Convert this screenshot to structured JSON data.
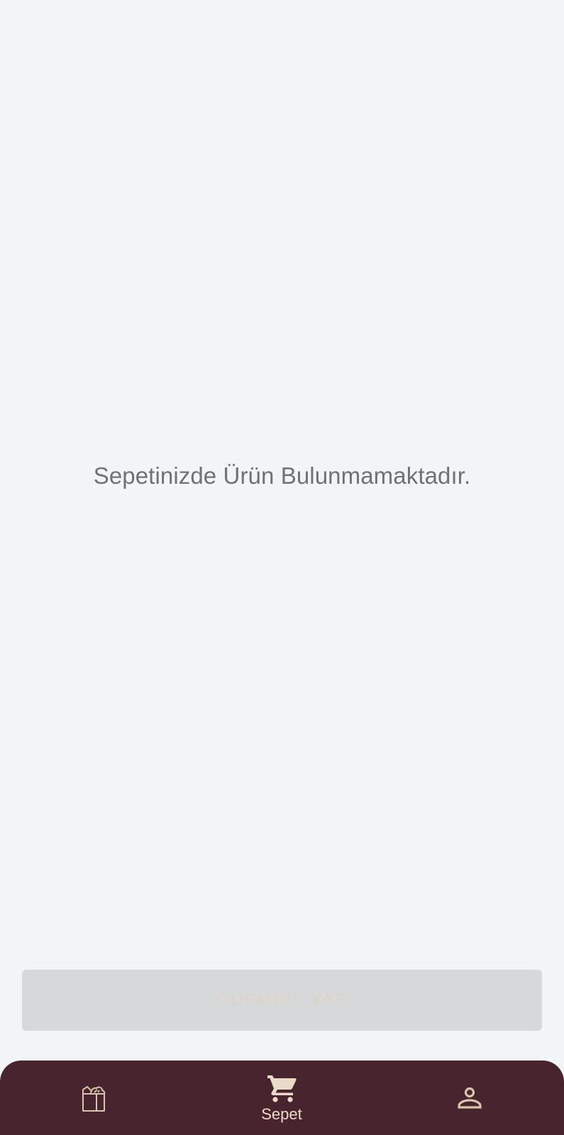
{
  "cart": {
    "empty_message": "Sepetinizde Ürün Bulunmamaktadır."
  },
  "checkout": {
    "pay_button_label": "ÖDEMEYİ YAP"
  },
  "bottom_nav": {
    "items": [
      {
        "id": "products",
        "icon": "grocery-bag-icon",
        "label": ""
      },
      {
        "id": "cart",
        "icon": "shopping-cart-icon",
        "label": "Sepet",
        "active": true
      },
      {
        "id": "account",
        "icon": "person-icon",
        "label": ""
      }
    ]
  },
  "colors": {
    "background": "#f2f5f6",
    "nav_background": "#48242f",
    "nav_foreground": "#e9dcc6",
    "disabled_button": "#d5d9da",
    "message_text": "#6f7173"
  }
}
